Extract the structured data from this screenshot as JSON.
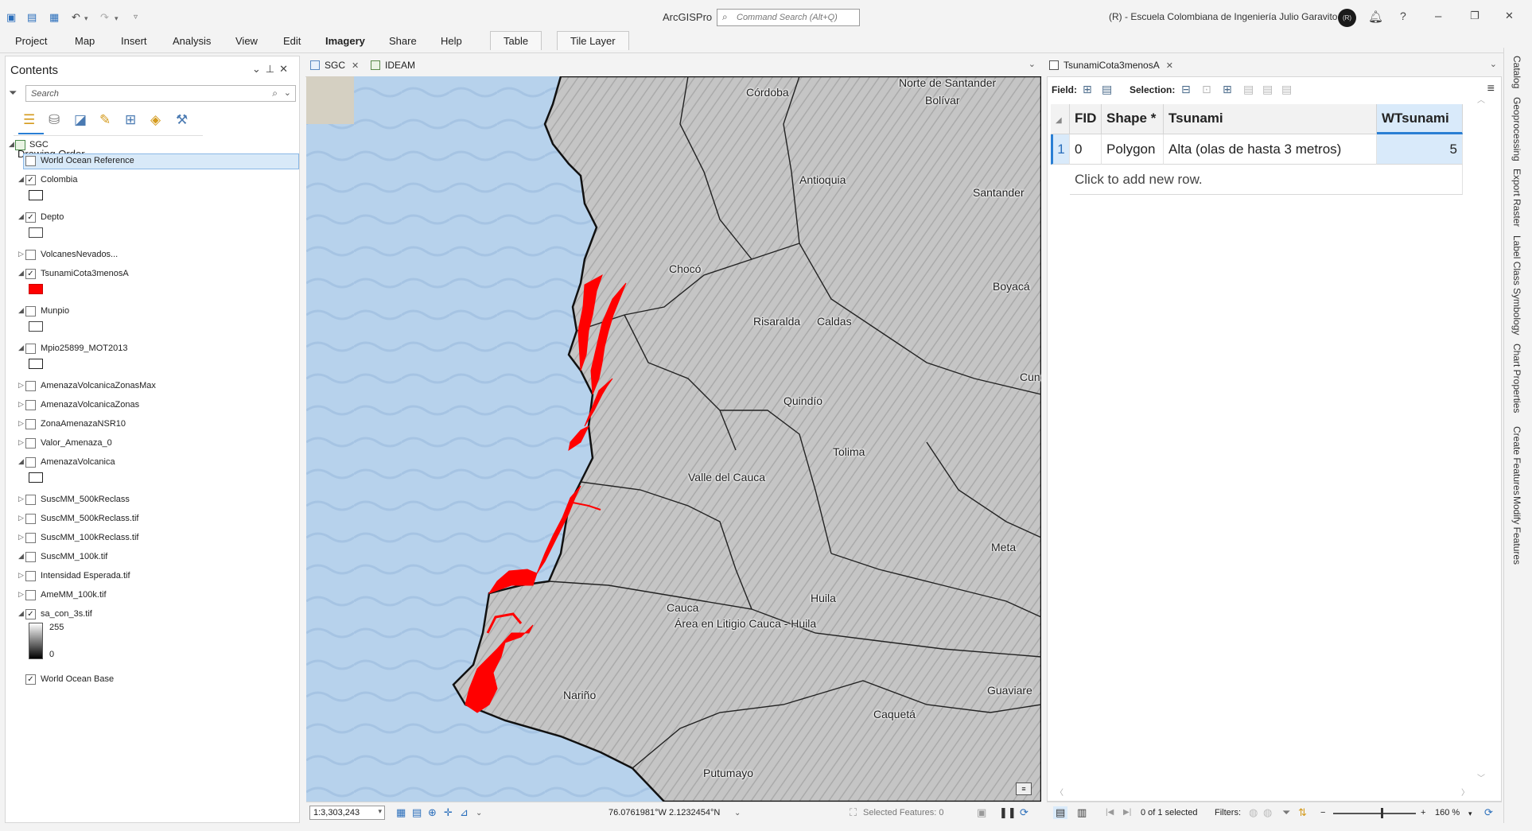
{
  "app": {
    "title": "ArcGISPro",
    "command_search_placeholder": "Command Search (Alt+Q)",
    "org": "(R) - Escuela Colombiana de Ingeniería Julio Garavito",
    "avatar_initials": "(R)",
    "window_controls": [
      "–",
      "❐",
      "✕"
    ]
  },
  "ribbon": {
    "tabs": [
      "Project",
      "Map",
      "Insert",
      "Analysis",
      "View",
      "Edit",
      "Imagery",
      "Share",
      "Help"
    ],
    "active_tab": "Imagery",
    "contextual_tabs": [
      "Table",
      "Tile Layer"
    ]
  },
  "contents": {
    "title": "Contents",
    "search_placeholder": "Search",
    "drawing_order_label": "Drawing Order",
    "root_layer": "SGC",
    "layers": [
      {
        "name": "World Ocean Reference",
        "checked": false,
        "expanded": null,
        "selected": true
      },
      {
        "name": "Colombia",
        "checked": true,
        "expanded": true
      },
      {
        "name": "Depto",
        "checked": true,
        "expanded": true
      },
      {
        "name": "VolcanesNevados...",
        "checked": false,
        "expanded": false
      },
      {
        "name": "TsunamiCota3menosA",
        "checked": true,
        "expanded": true
      },
      {
        "name": "Munpio",
        "checked": false,
        "expanded": true
      },
      {
        "name": "Mpio25899_MOT2013",
        "checked": false,
        "expanded": true
      },
      {
        "name": "AmenazaVolcanicaZonasMax",
        "checked": false,
        "expanded": false
      },
      {
        "name": "AmenazaVolcanicaZonas",
        "checked": false,
        "expanded": false
      },
      {
        "name": "ZonaAmenazaNSR10",
        "checked": false,
        "expanded": false
      },
      {
        "name": "Valor_Amenaza_0",
        "checked": false,
        "expanded": false
      },
      {
        "name": "AmenazaVolcanica",
        "checked": false,
        "expanded": true
      },
      {
        "name": "SuscMM_500kReclass",
        "checked": false,
        "expanded": false
      },
      {
        "name": "SuscMM_500kReclass.tif",
        "checked": false,
        "expanded": false
      },
      {
        "name": "SuscMM_100kReclass.tif",
        "checked": false,
        "expanded": false
      },
      {
        "name": "SuscMM_100k.tif",
        "checked": false,
        "expanded": true
      },
      {
        "name": "Intensidad Esperada.tif",
        "checked": false,
        "expanded": false
      },
      {
        "name": "AmeMM_100k.tif",
        "checked": false,
        "expanded": false
      },
      {
        "name": "sa_con_3s.tif",
        "checked": true,
        "expanded": true
      },
      {
        "name": "World Ocean Base",
        "checked": true,
        "expanded": null
      }
    ],
    "ramp_high": "255",
    "ramp_low": "0"
  },
  "map_view": {
    "tabs": [
      "SGC",
      "IDEAM"
    ],
    "active_tab": "SGC",
    "labels": [
      "Córdoba",
      "Norte de Santander",
      "Bolívar",
      "Antioquia",
      "Santander",
      "Chocó",
      "Boyacá",
      "Risaralda",
      "Caldas",
      "Cundinamarca",
      "Quindío",
      "Tolima",
      "Valle del Cauca",
      "Meta",
      "Cauca",
      "Huila",
      "Área en Litigio Cauca - Huila",
      "Nariño",
      "Guaviare",
      "Caquetá",
      "Putumayo"
    ],
    "scale": "1:3,303,243",
    "coordinates": "76.0761981°W 2.1232454°N",
    "selected_features": "Selected Features: 0"
  },
  "attribute_table": {
    "tab_title": "TsunamiCota3menosA",
    "toolbar_field_label": "Field:",
    "toolbar_selection_label": "Selection:",
    "columns": [
      "FID",
      "Shape *",
      "Tsunami",
      "WTsunami"
    ],
    "rows": [
      {
        "row_num": "1",
        "FID": "0",
        "Shape": "Polygon",
        "Tsunami": "Alta (olas de hasta 3 metros)",
        "WTsunami": "5"
      }
    ],
    "add_row_text": "Click to add new row.",
    "status": "0 of 1 selected",
    "filters_label": "Filters:",
    "zoom": "160 %"
  },
  "dock": {
    "items": [
      "Catalog",
      "Geoprocessing",
      "Export Raster",
      "Label Class",
      "Symbology",
      "Chart Properties",
      "Create Features",
      "Modify Features"
    ]
  },
  "colors": {
    "tsunami_fill": "#ff0000",
    "ocean": "#b7d2ec",
    "land": "#c9c9c9",
    "selection_highlight": "#d9eafa",
    "accent": "#2a7fd4"
  }
}
